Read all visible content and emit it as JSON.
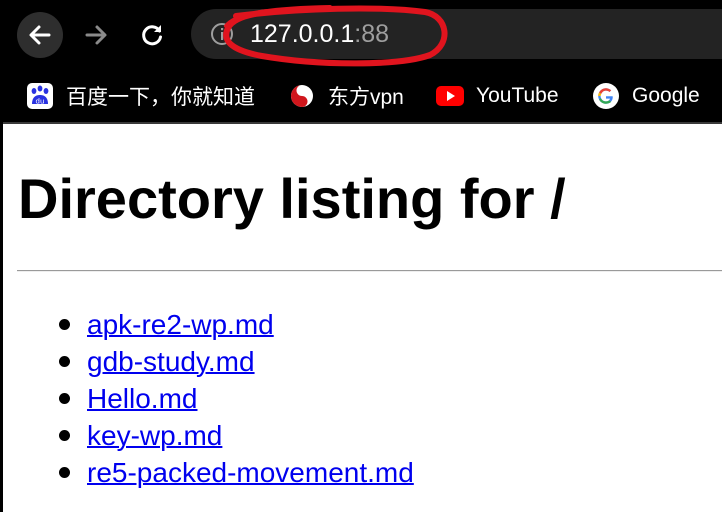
{
  "toolbar": {
    "url_host": "127.0.0.1",
    "url_port": ":88"
  },
  "bookmarks": [
    {
      "label": "百度一下，你就知道",
      "icon": "baidu-icon"
    },
    {
      "label": "东方vpn",
      "icon": "yin-yang-icon"
    },
    {
      "label": "YouTube",
      "icon": "youtube-icon"
    },
    {
      "label": "Google",
      "icon": "google-icon"
    }
  ],
  "page": {
    "title": "Directory listing for /",
    "files": [
      "apk-re2-wp.md",
      "gdb-study.md",
      "Hello.md",
      "key-wp.md",
      "re5-packed-movement.md"
    ]
  },
  "colors": {
    "chrome_bg": "#000000",
    "omnibox_bg": "#232323",
    "link": "#0000ee",
    "annotation": "#e0141e"
  }
}
